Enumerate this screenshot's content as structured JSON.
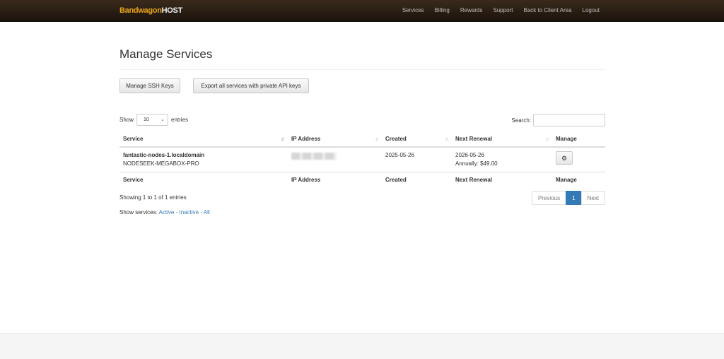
{
  "brand": {
    "part1": "Bandwagon",
    "part2": "HOST"
  },
  "nav": [
    "Services",
    "Billing",
    "Rewards",
    "Support",
    "Back to Client Area",
    "Logout"
  ],
  "page_title": "Manage Services",
  "buttons": {
    "ssh": "Manage SSH Keys",
    "export": "Export all services with private API keys"
  },
  "length": {
    "show": "Show",
    "value": "10",
    "entries": "entries"
  },
  "search": {
    "label": "Search:",
    "value": ""
  },
  "table": {
    "headers": [
      "Service",
      "IP Address",
      "Created",
      "Next Renewal",
      "Manage"
    ],
    "rows": [
      {
        "service": "fantastic-nodes-1.localdomain",
        "plan": "NODESEEK-MEGABOX-PRO",
        "created": "2025-05-26",
        "renewal": "2026-05-26",
        "billing": "Annually: $49.00"
      }
    ]
  },
  "info": "Showing 1 to 1 of 1 entries",
  "pagination": {
    "previous": "Previous",
    "current": "1",
    "next": "Next"
  },
  "filters": {
    "label": "Show services:",
    "active": "Active",
    "inactive": "Inactive",
    "all": "All",
    "sep": "·"
  },
  "colors": {
    "accent": "#337ab7",
    "brand_orange": "#e9a51d",
    "topbar": "#2a1d12"
  },
  "icons": {
    "manage": "gear-icon",
    "sort": "sort-icon"
  }
}
